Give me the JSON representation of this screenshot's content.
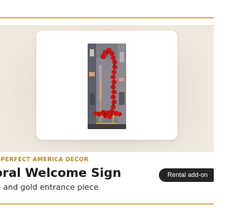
{
  "gallery": {
    "image_alt": "Floral welcome sign photo"
  },
  "product": {
    "brand": "TY PERFECT AMERICA DECOR",
    "title": "oral Welcome Sign",
    "subtitle": "d and gold entrance piece",
    "badge_label": "Rental add-on"
  },
  "colors": {
    "accent_gold": "#b98a2e",
    "line_gold": "#d8b86a",
    "backdrop": "#efe8dc",
    "button_bg": "#242424",
    "flower_red": "#c8140f"
  }
}
